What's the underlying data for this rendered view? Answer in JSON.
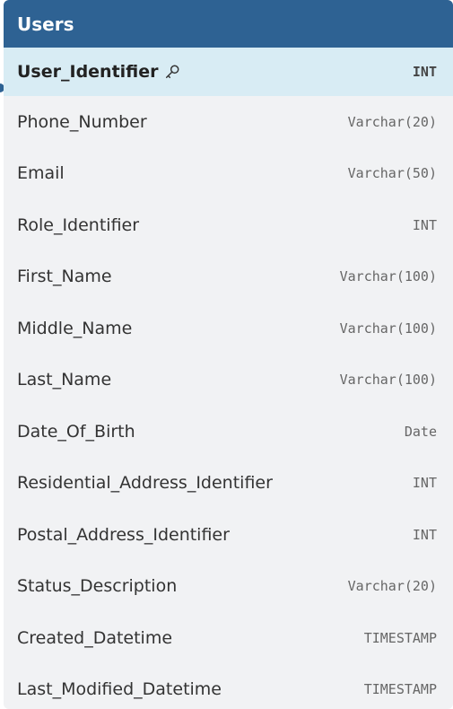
{
  "table": {
    "title": "Users",
    "columns": [
      {
        "name": "User_Identifier",
        "type": "INT",
        "primary_key": true
      },
      {
        "name": "Phone_Number",
        "type": "Varchar(20)"
      },
      {
        "name": "Email",
        "type": "Varchar(50)"
      },
      {
        "name": "Role_Identifier",
        "type": "INT"
      },
      {
        "name": "First_Name",
        "type": "Varchar(100)"
      },
      {
        "name": "Middle_Name",
        "type": "Varchar(100)"
      },
      {
        "name": "Last_Name",
        "type": "Varchar(100)"
      },
      {
        "name": "Date_Of_Birth",
        "type": "Date"
      },
      {
        "name": "Residential_Address_Identifier",
        "type": "INT"
      },
      {
        "name": "Postal_Address_Identifier",
        "type": "INT"
      },
      {
        "name": "Status_Description",
        "type": "Varchar(20)"
      },
      {
        "name": "Created_Datetime",
        "type": "TIMESTAMP"
      },
      {
        "name": "Last_Modified_Datetime",
        "type": "TIMESTAMP"
      }
    ]
  },
  "colors": {
    "header_bg": "#2e6293",
    "primary_key_row_bg": "#d8ecf4",
    "card_bg": "#f1f2f4"
  },
  "icons": {
    "primary_key": "key-icon"
  }
}
